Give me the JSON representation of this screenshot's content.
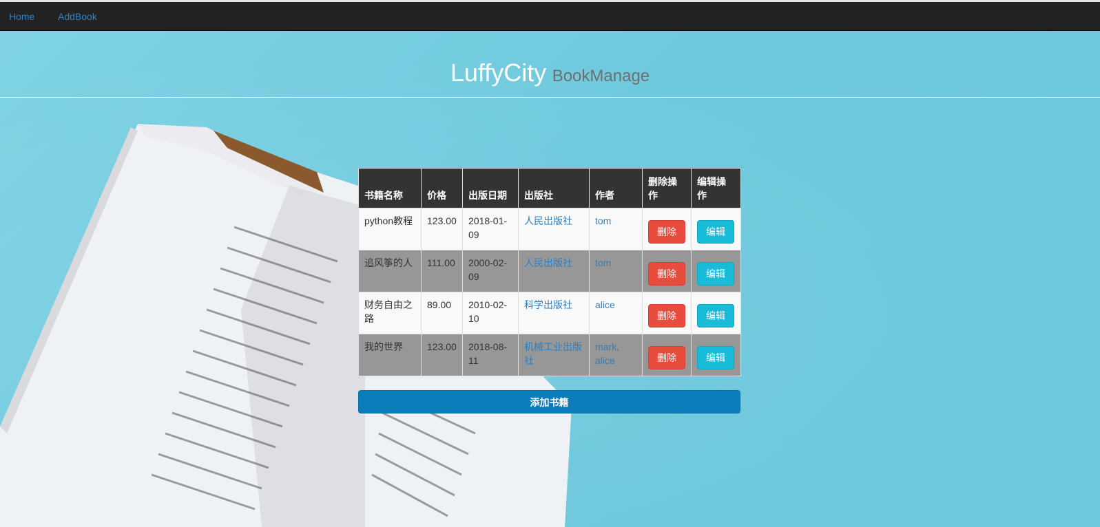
{
  "nav": {
    "items": [
      {
        "label": "Home"
      },
      {
        "label": "AddBook"
      }
    ]
  },
  "header": {
    "title": "LuffyCity",
    "subtitle": "BookManage"
  },
  "table": {
    "columns": [
      "书籍名称",
      "价格",
      "出版日期",
      "出版社",
      "作者",
      "删除操作",
      "编辑操作"
    ],
    "rows": [
      {
        "name": "python教程",
        "price": "123.00",
        "date": "2018-01-09",
        "publisher": "人民出版社",
        "author": "tom",
        "delete_label": "删除",
        "edit_label": "编辑"
      },
      {
        "name": "追风筝的人",
        "price": "111.00",
        "date": "2000-02-09",
        "publisher": "人民出版社",
        "author": "tom",
        "delete_label": "删除",
        "edit_label": "编辑"
      },
      {
        "name": "财务自由之路",
        "price": "89.00",
        "date": "2010-02-10",
        "publisher": "科学出版社",
        "author": "alice",
        "delete_label": "删除",
        "edit_label": "编辑"
      },
      {
        "name": "我的世界",
        "price": "123.00",
        "date": "2018-08-11",
        "publisher": "机械工业出版社",
        "author": "mark, alice",
        "delete_label": "删除",
        "edit_label": "编辑"
      }
    ]
  },
  "add_button": {
    "label": "添加书籍"
  },
  "colors": {
    "navbar": "#222222",
    "link": "#2f82c4",
    "delete": "#e74c3c",
    "edit": "#18bbd8",
    "primary": "#0b7dbb",
    "background": "#72cde0"
  }
}
